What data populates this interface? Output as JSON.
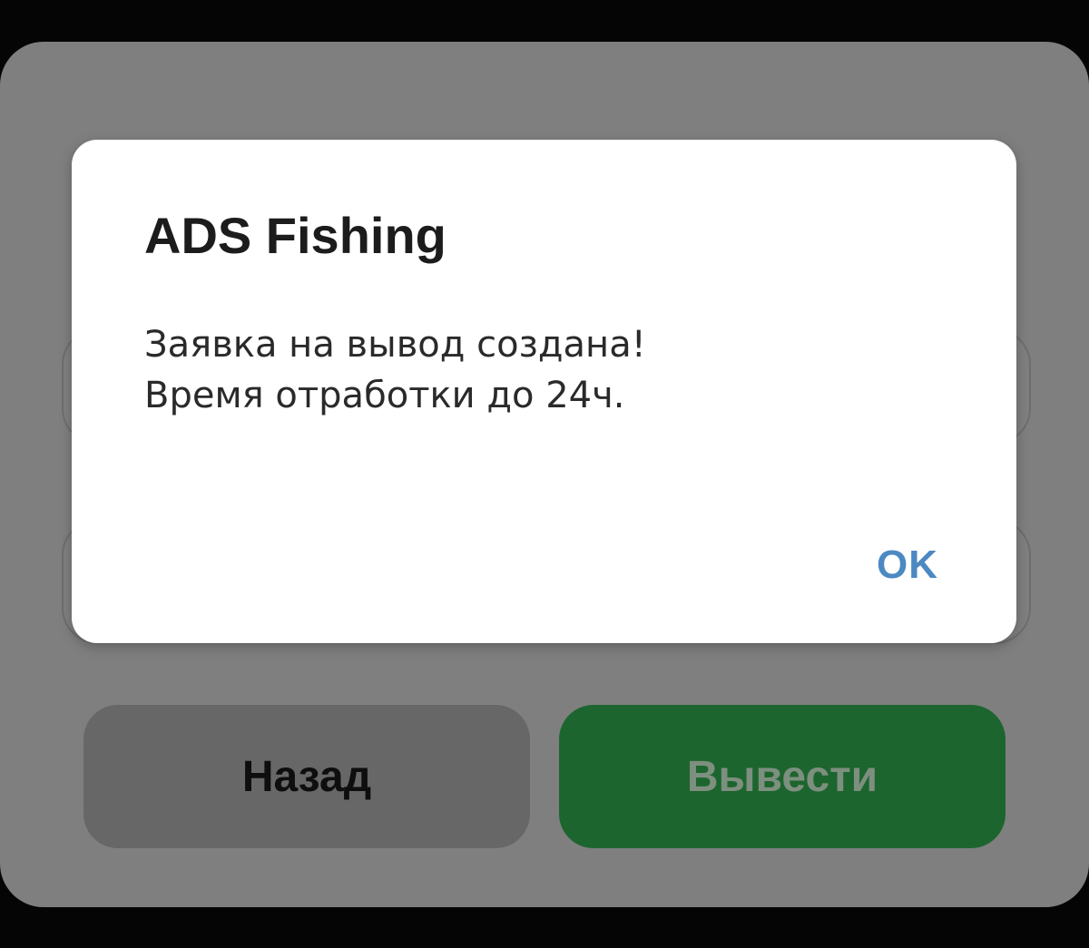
{
  "background": {
    "back_button_label": "Назад",
    "withdraw_button_label": "Вывести"
  },
  "dialog": {
    "title": "ADS Fishing",
    "message_line1": "Заявка на вывод создана!",
    "message_line2": "Время отработки до 24ч.",
    "ok_label": "OK"
  },
  "colors": {
    "dialog_button_text": "#4c89c2",
    "withdraw_button_bg": "#1d652e",
    "overlay_dim": "#7f7f7f"
  }
}
